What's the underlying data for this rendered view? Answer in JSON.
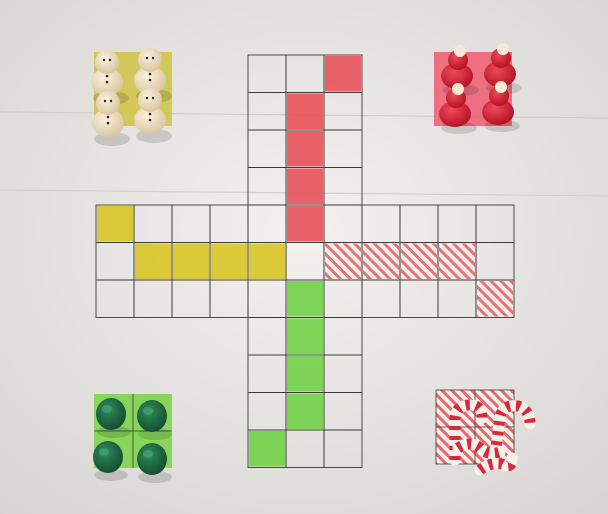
{
  "image": {
    "description_free": true
  },
  "board": {
    "rows": 11,
    "cols": 11,
    "paper_color": "#eeedea",
    "line_color": "#3a3a3a"
  },
  "colors": {
    "yellow": "#d9c62a",
    "red": "#e8555c",
    "green": "#74d14a",
    "striped": "#e66a6a",
    "wood": "#efe0c4",
    "dark_green": "#1f6b45",
    "santa_red": "#d81c32"
  },
  "home_bases": [
    {
      "name": "yellow-home",
      "color": "#cfc342",
      "pieces": 4,
      "piece_type": "snowman"
    },
    {
      "name": "red-home",
      "color": "#ee5a70",
      "pieces": 4,
      "piece_type": "santa"
    },
    {
      "name": "green-home",
      "color": "#7fd34d",
      "pieces": 4,
      "piece_type": "tree"
    },
    {
      "name": "striped-home",
      "color": "#e9a0a0",
      "pieces": 4,
      "piece_type": "candy-cane"
    }
  ]
}
